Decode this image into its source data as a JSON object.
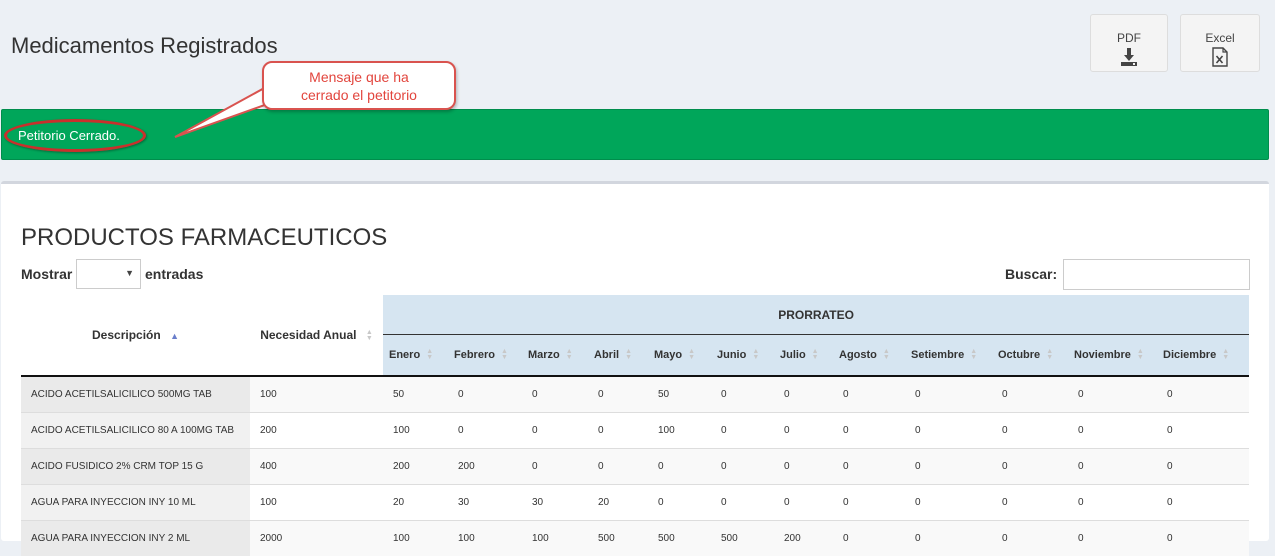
{
  "page": {
    "title": "Medicamentos Registrados"
  },
  "export": {
    "pdf_label": "PDF",
    "excel_label": "Excel"
  },
  "annotation": {
    "line1": "Mensaje que ha",
    "line2": "cerrado el petitorio"
  },
  "alert": {
    "message": "Petitorio Cerrado.",
    "color": "#00a65a"
  },
  "section": {
    "title": "PRODUCTOS FARMACEUTICOS"
  },
  "length": {
    "prefix": "Mostrar",
    "value": "",
    "suffix": "entradas"
  },
  "search": {
    "label": "Buscar:",
    "value": ""
  },
  "table": {
    "group_header": "PRORRATEO",
    "col_desc": "Descripción",
    "col_need": "Necesidad Anual",
    "months": [
      "Enero",
      "Febrero",
      "Marzo",
      "Abril",
      "Mayo",
      "Junio",
      "Julio",
      "Agosto",
      "Setiembre",
      "Octubre",
      "Noviembre",
      "Diciembre"
    ],
    "rows": [
      {
        "desc": "ACIDO ACETILSALICILICO 500MG TAB",
        "need": "100",
        "months": [
          "50",
          "0",
          "0",
          "0",
          "50",
          "0",
          "0",
          "0",
          "0",
          "0",
          "0",
          "0"
        ]
      },
      {
        "desc": "ACIDO ACETILSALICILICO 80 A 100MG TAB",
        "need": "200",
        "months": [
          "100",
          "0",
          "0",
          "0",
          "100",
          "0",
          "0",
          "0",
          "0",
          "0",
          "0",
          "0"
        ]
      },
      {
        "desc": "ACIDO FUSIDICO 2% CRM TOP 15 G",
        "need": "400",
        "months": [
          "200",
          "200",
          "0",
          "0",
          "0",
          "0",
          "0",
          "0",
          "0",
          "0",
          "0",
          "0"
        ]
      },
      {
        "desc": "AGUA PARA INYECCION INY 10 ML",
        "need": "100",
        "months": [
          "20",
          "30",
          "30",
          "20",
          "0",
          "0",
          "0",
          "0",
          "0",
          "0",
          "0",
          "0"
        ]
      },
      {
        "desc": "AGUA PARA INYECCION INY 2 ML",
        "need": "2000",
        "months": [
          "100",
          "100",
          "100",
          "500",
          "500",
          "500",
          "200",
          "0",
          "0",
          "0",
          "0",
          "0"
        ]
      }
    ]
  }
}
